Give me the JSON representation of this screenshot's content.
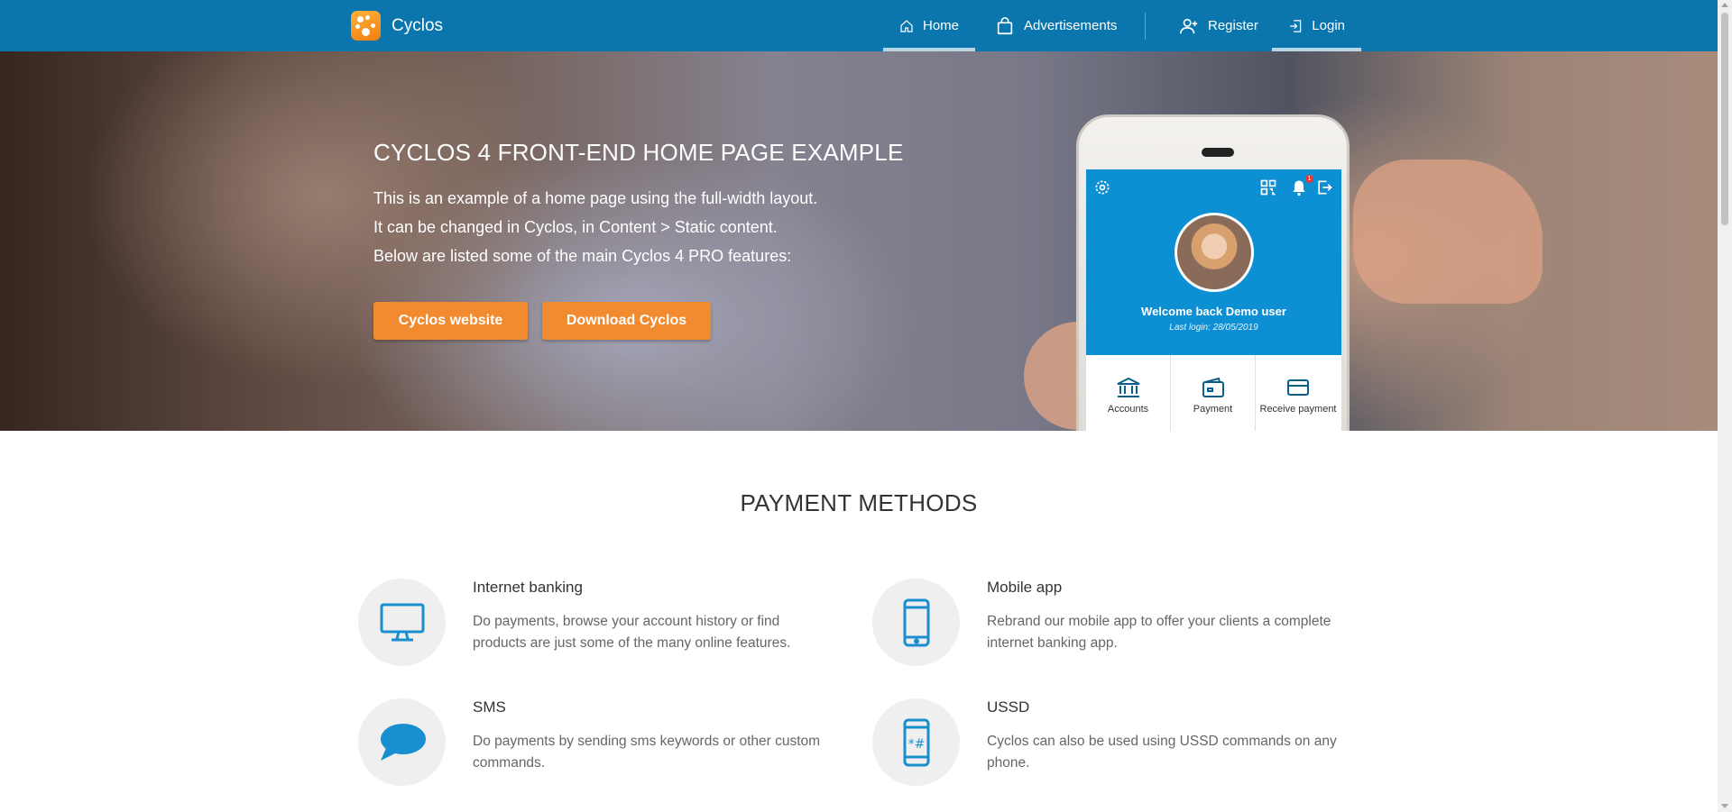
{
  "header": {
    "brand": "Cyclos",
    "nav": [
      {
        "label": "Home",
        "icon": "home-icon",
        "active": true
      },
      {
        "label": "Advertisements",
        "icon": "shopping-bag-icon",
        "active": false
      },
      {
        "label": "Register",
        "icon": "add-user-icon",
        "active": false
      },
      {
        "label": "Login",
        "icon": "login-icon",
        "active": true
      }
    ]
  },
  "hero": {
    "title": "CYCLOS 4 FRONT-END HOME PAGE EXAMPLE",
    "lines": [
      "This is an example of a home page using the full-width layout.",
      "It can be changed in Cyclos, in Content > Static content.",
      "Below are listed some of the main Cyclos 4 PRO features:"
    ],
    "buttons": [
      "Cyclos website",
      "Download Cyclos"
    ]
  },
  "phone": {
    "notification_count": "1",
    "welcome": "Welcome back Demo user",
    "last_login": "Last login: 28/05/2019",
    "tiles": [
      "Accounts",
      "Payment",
      "Receive payment"
    ]
  },
  "payment_methods": {
    "title": "PAYMENT METHODS",
    "items": [
      {
        "title": "Internet banking",
        "icon": "monitor-icon",
        "desc": [
          "Do payments, browse your account history or find",
          "products are just some of the many online features."
        ]
      },
      {
        "title": "Mobile app",
        "icon": "smartphone-icon",
        "desc": [
          "Rebrand our mobile app to offer your clients a complete",
          "internet banking app."
        ]
      },
      {
        "title": "SMS",
        "icon": "chat-bubble-icon",
        "desc": [
          "Do payments by sending sms keywords or other custom",
          "commands."
        ]
      },
      {
        "title": "USSD",
        "icon": "ussd-phone-icon",
        "desc": [
          "Cyclos can also be used using USSD commands on any",
          "phone."
        ]
      }
    ]
  },
  "colors": {
    "header": "#0a76ad",
    "accent_orange": "#f28a30",
    "app_blue": "#0d8fd3",
    "icon_blue": "#1a8fcf"
  }
}
